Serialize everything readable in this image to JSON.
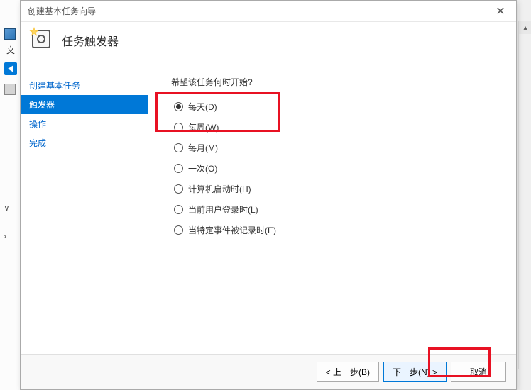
{
  "dialog": {
    "title": "创建基本任务向导",
    "header": "任务触发器"
  },
  "sidebar": {
    "items": [
      {
        "label": "创建基本任务",
        "active": false
      },
      {
        "label": "触发器",
        "active": true
      },
      {
        "label": "操作",
        "active": false
      },
      {
        "label": "完成",
        "active": false
      }
    ]
  },
  "main": {
    "question": "希望该任务何时开始?",
    "options": [
      {
        "label": "每天(D)",
        "selected": true
      },
      {
        "label": "每周(W)",
        "selected": false
      },
      {
        "label": "每月(M)",
        "selected": false
      },
      {
        "label": "一次(O)",
        "selected": false
      },
      {
        "label": "计算机启动时(H)",
        "selected": false
      },
      {
        "label": "当前用户登录时(L)",
        "selected": false
      },
      {
        "label": "当特定事件被记录时(E)",
        "selected": false
      }
    ]
  },
  "footer": {
    "back": "< 上一步(B)",
    "next": "下一步(N) >",
    "cancel": "取消"
  },
  "background": {
    "left_text": "文"
  }
}
